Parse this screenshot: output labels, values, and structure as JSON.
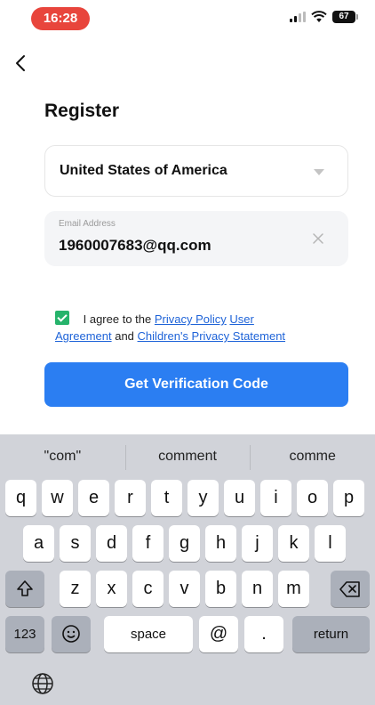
{
  "status_bar": {
    "time": "16:28",
    "battery": "67"
  },
  "register": {
    "title": "Register",
    "country": "United States of America",
    "email_label": "Email Address",
    "email_value": "1960007683@qq.com",
    "agree_text": "I agree to the",
    "privacy_policy": "Privacy Policy",
    "user_agreement_1": "User",
    "user_agreement_2": "Agreement",
    "and": "and",
    "childrens_privacy": "Children's Privacy Statement",
    "button": "Get Verification Code"
  },
  "keyboard": {
    "suggestions": [
      "\"com\"",
      "comment",
      "comme"
    ],
    "row1": [
      "q",
      "w",
      "e",
      "r",
      "t",
      "y",
      "u",
      "i",
      "o",
      "p"
    ],
    "row2": [
      "a",
      "s",
      "d",
      "f",
      "g",
      "h",
      "j",
      "k",
      "l"
    ],
    "row3": [
      "z",
      "x",
      "c",
      "v",
      "b",
      "n",
      "m"
    ],
    "num_key": "123",
    "space": "space",
    "at": "@",
    "dot": ".",
    "return": "return"
  },
  "colors": {
    "accent": "#2b7ef2",
    "check": "#26b36b",
    "link": "#1e63d8",
    "time_pill": "#e8453c"
  },
  "icons": [
    "back-arrow-icon",
    "signal-icon",
    "wifi-icon",
    "battery-icon",
    "dropdown-caret-icon",
    "clear-icon",
    "checkmark-icon",
    "shift-icon",
    "backspace-icon",
    "emoji-icon",
    "globe-icon"
  ]
}
